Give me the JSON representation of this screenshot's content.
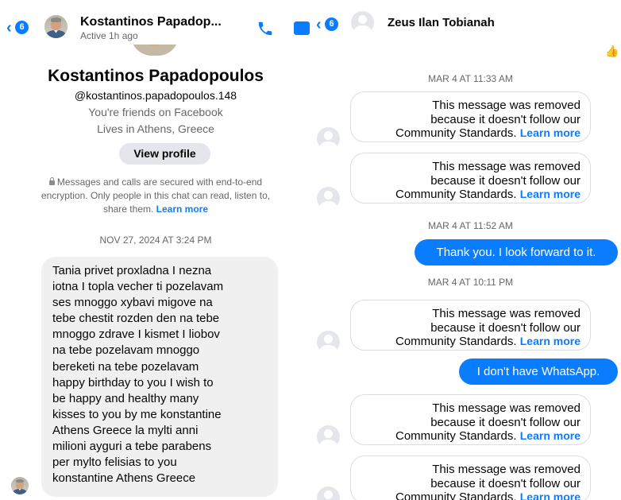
{
  "colors": {
    "accent": "#0a7cff",
    "bubble_gray": "#f0f0f0",
    "secondary_text": "#65676b"
  },
  "left": {
    "header": {
      "back_badge": "6",
      "name": "Kostantinos Papadop...",
      "status": "Active 1h ago",
      "call_icon": "phone-icon",
      "video_icon": "video-icon"
    },
    "profile": {
      "name": "Kostantinos Papadopoulos",
      "handle": "@kostantinos.papadopoulos.148",
      "friends": "You're friends on Facebook",
      "lives": "Lives in Athens, Greece",
      "view_profile": "View profile"
    },
    "encryption": {
      "line1": "Messages and calls are secured with end-to-end",
      "line2": "encryption. Only people in this chat can read, listen to,",
      "line3": "share them.",
      "link": "Learn more"
    },
    "timestamp": "NOV 27, 2024 AT 3:24 PM",
    "message_lines": [
      "Tania privet proxladna I nezna",
      "iotna I topla vecher ti pozelavam",
      "ses mnoggo xybavi migove na",
      "tebe chestit rozden den na tebe",
      "mnoggo zdrave I kismet I liobov",
      "na tebe pozelavam mnoggo",
      "bereketi na tebe pozelavam",
      "happy birthday to you I wish to",
      "be happy and healthy many",
      "kisses to you by me konstantine",
      "Athens Greece la mylti anni",
      "milioni ayguri a tebe parabens",
      "per mylto felisias to you",
      "konstantine Athens Greece"
    ]
  },
  "right": {
    "header": {
      "back_badge": "6",
      "name": "Zeus Ilan Tobianah"
    },
    "removed_line1": "This message was removed",
    "removed_line2": "because it doesn't follow our",
    "removed_line3": "Community Standards.",
    "removed_link": "Learn more",
    "ts1": "MAR 4 AT 11:33 AM",
    "ts2": "MAR 4 AT 11:52 AM",
    "ts3": "MAR 4 AT 10:11 PM",
    "sent1": "Thank you. I look forward to it.",
    "sent2": "I don't have WhatsApp.",
    "reaction_icon": "thumbs-up-icon"
  }
}
